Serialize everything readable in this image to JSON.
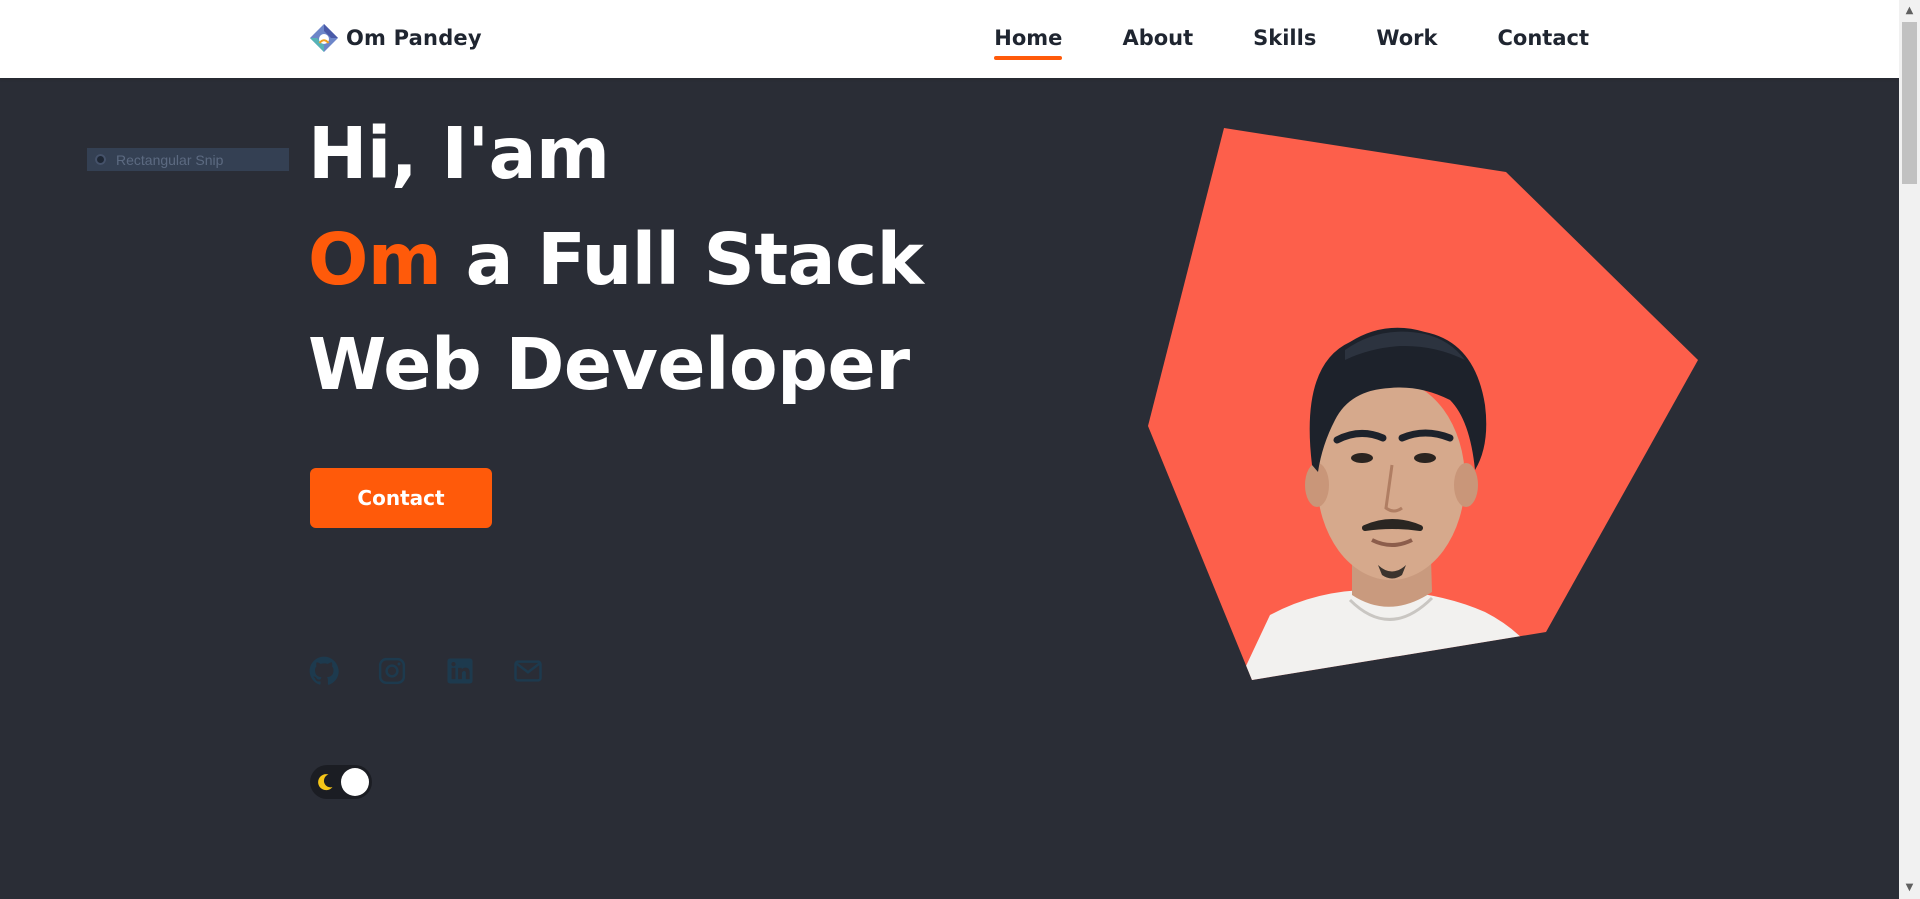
{
  "brand": {
    "name": "Om Pandey",
    "logo_icon": "diamond-logo-icon"
  },
  "nav": {
    "items": [
      {
        "label": "Home",
        "active": true
      },
      {
        "label": "About",
        "active": false
      },
      {
        "label": "Skills",
        "active": false
      },
      {
        "label": "Work",
        "active": false
      },
      {
        "label": "Contact",
        "active": false
      }
    ]
  },
  "snip": {
    "label": "Rectangular Snip"
  },
  "hero": {
    "line1": "Hi, I'am",
    "line2_accent": "Om",
    "line2_rest": "a Full Stack",
    "line3": "Web Developer",
    "contact_label": "Contact",
    "photo_icon": "profile-photo"
  },
  "socials": [
    {
      "name": "github-icon"
    },
    {
      "name": "instagram-icon"
    },
    {
      "name": "linkedin-icon"
    },
    {
      "name": "mail-icon"
    }
  ],
  "theme_toggle": {
    "mode": "dark",
    "icon": "moon-icon"
  },
  "colors": {
    "background": "#2a2d36",
    "accent": "#ff5a0a",
    "photo_shape": "#fd5f4b",
    "header_bg": "#ffffff",
    "social_icon": "#1d3a4e"
  }
}
